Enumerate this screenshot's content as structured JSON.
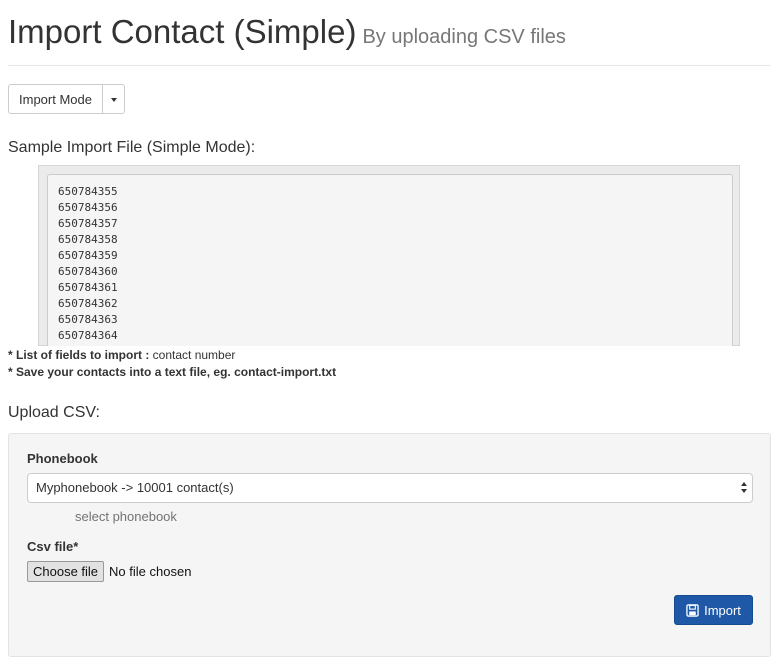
{
  "header": {
    "title": "Import Contact (Simple)",
    "subtitle": "By uploading CSV files"
  },
  "mode_menu": {
    "label": "Import Mode"
  },
  "sample": {
    "title": "Sample Import File (Simple Mode):",
    "lines": [
      "650784355",
      "650784356",
      "650784357",
      "650784358",
      "650784359",
      "650784360",
      "650784361",
      "650784362",
      "650784363",
      "650784364"
    ]
  },
  "notes": {
    "fields_label": "* List of fields to import :",
    "fields_value": "contact number",
    "save_note": "* Save your contacts into a text file, eg. contact-import.txt"
  },
  "upload": {
    "title": "Upload CSV:",
    "phonebook_label": "Phonebook",
    "phonebook_value": "Myphonebook -> 10001 contact(s)",
    "phonebook_help": "select phonebook",
    "csv_label": "Csv file*",
    "choose_file_label": "Choose file",
    "file_status": "No file chosen",
    "import_label": "Import",
    "import_icon": "floppy-disk-icon"
  },
  "colors": {
    "primary_button": "#1e58a6",
    "well_background": "#f5f5f5"
  }
}
